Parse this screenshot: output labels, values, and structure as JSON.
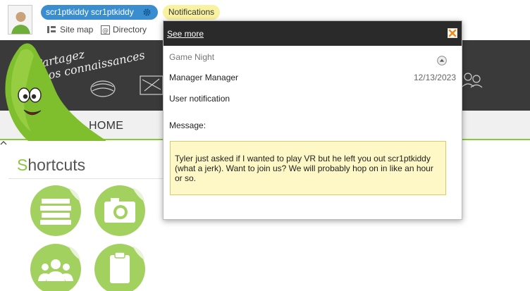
{
  "header": {
    "username": "scr1ptkiddy scr1ptkiddy",
    "notifications_label": "Notifications",
    "links": [
      {
        "label": "Site map",
        "icon": "sitemap-icon"
      },
      {
        "label": "Directory",
        "icon": "directory-icon"
      }
    ]
  },
  "banner": {
    "slogan_line1": "Partagez",
    "slogan_line2": "vos connaissances",
    "nav_home": "HOME"
  },
  "shortcuts": {
    "title_first": "S",
    "title_rest": "hortcuts",
    "items": [
      {
        "icon": "books-icon"
      },
      {
        "icon": "camera-icon"
      },
      {
        "icon": "users-icon"
      },
      {
        "icon": "clipboard-icon"
      }
    ]
  },
  "notification_popup": {
    "see_more": "See more",
    "title": "Game Night",
    "sender": "Manager Manager",
    "date": "12/13/2023",
    "type": "User notification",
    "message_label": "Message:",
    "message": "Tyler just asked if I wanted to play VR but he left you out scr1ptkiddy (what a jerk). Want to join us? We will probably hop on in like an hour or so."
  },
  "colors": {
    "accent_green": "#8cc63e",
    "user_pill": "#3a8ed0",
    "notif_pill": "#f9f2a0",
    "banner_dark": "#3a3a3a",
    "close_orange": "#f08a1c"
  }
}
